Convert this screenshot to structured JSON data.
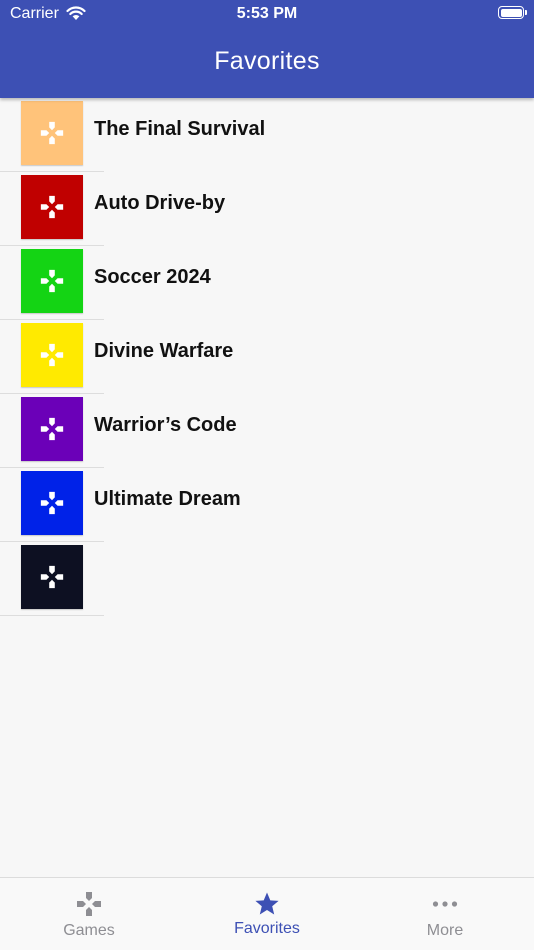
{
  "status_bar": {
    "carrier": "Carrier",
    "time": "5:53 PM",
    "icons": [
      "wifi-icon",
      "battery-icon"
    ]
  },
  "header": {
    "title": "Favorites",
    "color": "#3d50b4"
  },
  "games": [
    {
      "title": "The Final Survival",
      "color": "#ffc37a",
      "icon": "gamepad-icon"
    },
    {
      "title": "Auto Drive-by",
      "color": "#c00000",
      "icon": "gamepad-icon"
    },
    {
      "title": "Soccer 2024",
      "color": "#14d414",
      "icon": "gamepad-icon"
    },
    {
      "title": "Divine Warfare",
      "color": "#ffea00",
      "icon": "gamepad-icon"
    },
    {
      "title": "Warrior’s Code",
      "color": "#6b00b8",
      "icon": "gamepad-icon"
    },
    {
      "title": "Ultimate Dream",
      "color": "#0022e8",
      "icon": "gamepad-icon"
    },
    {
      "title": "",
      "color": "#0d1022",
      "icon": "gamepad-icon"
    }
  ],
  "tabs": [
    {
      "label": "Games",
      "icon": "gamepad-icon",
      "active": false
    },
    {
      "label": "Favorites",
      "icon": "star-icon",
      "active": true
    },
    {
      "label": "More",
      "icon": "more-dots-icon",
      "active": false
    }
  ],
  "colors": {
    "active_tab": "#3d50b4",
    "inactive_tab": "#8e8e93"
  }
}
